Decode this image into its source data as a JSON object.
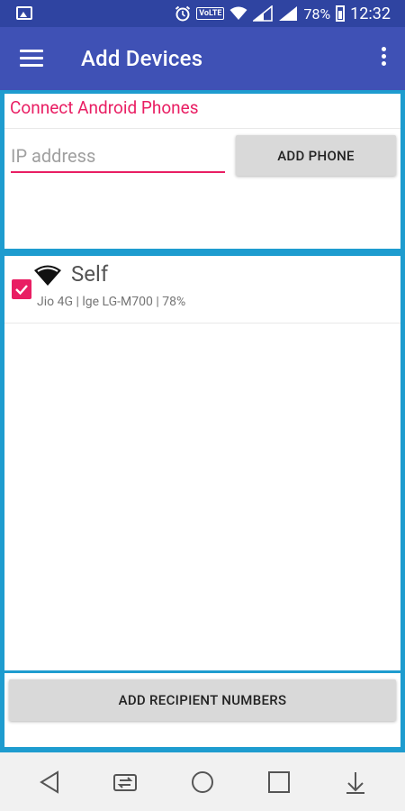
{
  "status_bar": {
    "battery": "78%",
    "time": "12:32",
    "volte": "VoLTE",
    "icons": [
      "gallery-icon",
      "alarm-icon",
      "volte-icon",
      "wifi-icon",
      "cell-signal-icon",
      "cell-signal-icon",
      "battery-icon"
    ]
  },
  "app_bar": {
    "title": "Add Devices",
    "icons": [
      "hamburger-menu-icon",
      "overflow-menu-icon"
    ]
  },
  "connect": {
    "title": "Connect Android Phones",
    "ip_placeholder": "IP address",
    "ip_value": "",
    "add_phone_label": "ADD PHONE"
  },
  "devices": [
    {
      "name": "Self",
      "info": "Jio 4G | lge LG-M700 | 78%",
      "checked": true,
      "icon": "wifi-icon"
    }
  ],
  "bottom": {
    "add_recipients_label": "ADD RECIPIENT NUMBERS"
  },
  "nav_bar": {
    "icons": [
      "back-icon",
      "switch-sim-icon",
      "home-icon",
      "recents-icon",
      "notification-pull-icon"
    ]
  },
  "colors": {
    "status_bar": "#2f44a1",
    "app_bar": "#3f51b5",
    "accent": "#e91e63",
    "frame": "#1e9ccf",
    "button": "#d9d9d9"
  }
}
